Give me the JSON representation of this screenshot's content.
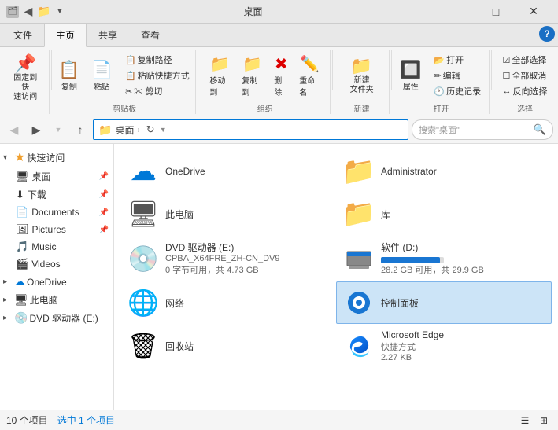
{
  "titlebar": {
    "title": "桌面",
    "min_label": "—",
    "max_label": "□",
    "close_label": "✕"
  },
  "ribbon": {
    "tabs": [
      "文件",
      "主页",
      "共享",
      "查看"
    ],
    "active_tab": "主页",
    "groups": {
      "quickaccess": {
        "label": "固定到快速访问",
        "icon": "📌"
      },
      "clipboard": {
        "label": "剪贴板",
        "copy": "复制",
        "paste": "粘贴",
        "cut": "✂ 剪切",
        "copy_path": "复制路径",
        "paste_shortcut": "粘贴快捷方式"
      },
      "organize": {
        "label": "组织",
        "move": "移动到",
        "copy": "复制到",
        "delete": "删除",
        "rename": "重命名"
      },
      "new": {
        "label": "新建",
        "new_folder": "新建\n文件夹"
      },
      "open": {
        "label": "打开",
        "open": "打开",
        "edit": "编辑",
        "history": "历史记录",
        "properties": "属性"
      },
      "select": {
        "label": "选择",
        "all": "全部选择",
        "none": "全部取消",
        "invert": "反向选择"
      }
    },
    "help_label": "?"
  },
  "addressbar": {
    "back_disabled": false,
    "forward_disabled": true,
    "up_disabled": false,
    "path": "桌面",
    "search_placeholder": "搜索\"桌面\""
  },
  "sidebar": {
    "quickaccess_label": "快速访问",
    "items": [
      {
        "label": "桌面",
        "pinned": true,
        "indent": 1
      },
      {
        "label": "下载",
        "pinned": true,
        "indent": 1
      },
      {
        "label": "Documents",
        "pinned": true,
        "indent": 1
      },
      {
        "label": "Pictures",
        "pinned": true,
        "indent": 1
      },
      {
        "label": "Music",
        "indent": 1
      },
      {
        "label": "Videos",
        "indent": 1
      }
    ],
    "onedrive": {
      "label": "OneDrive",
      "collapsed": true
    },
    "thispc": {
      "label": "此电脑",
      "collapsed": true
    },
    "dvd": {
      "label": "DVD 驱动器 (E:)",
      "collapsed": true
    }
  },
  "files": [
    {
      "name": "OneDrive",
      "type": "cloud",
      "detail": ""
    },
    {
      "name": "Administrator",
      "type": "folder_yellow",
      "detail": ""
    },
    {
      "name": "此电脑",
      "type": "computer",
      "detail": ""
    },
    {
      "name": "库",
      "type": "folder_blue",
      "detail": ""
    },
    {
      "name": "DVD 驱动器 (E:)\nCPBA_X64FRE_ZH-CN_DV9",
      "type": "dvd",
      "detail": "0 字节可用，共 4.73 GB"
    },
    {
      "name": "软件 (D:)",
      "type": "disk",
      "detail": "28.2 GB 可用，共 29.9 GB"
    },
    {
      "name": "网络",
      "type": "network",
      "detail": ""
    },
    {
      "name": "控制面板",
      "type": "control",
      "detail": "",
      "selected": true
    },
    {
      "name": "回收站",
      "type": "trash",
      "detail": ""
    },
    {
      "name": "Microsoft Edge",
      "type": "edge",
      "detail": "快捷方式\n2.27 KB"
    }
  ],
  "statusbar": {
    "count": "10 个项目",
    "selected": "选中 1 个项目"
  }
}
